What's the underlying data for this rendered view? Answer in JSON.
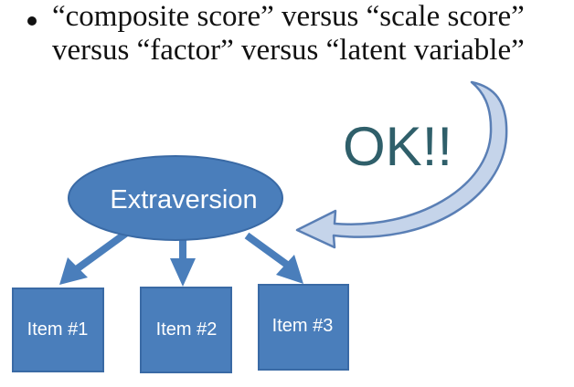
{
  "bullet": {
    "line1": "“composite score” versus “scale score”",
    "line2": "versus “factor” versus “latent variable”"
  },
  "callout": {
    "text": "OK!!"
  },
  "diagram": {
    "latent": "Extraversion",
    "items": [
      "Item #1",
      "Item #2",
      "Item #3"
    ]
  },
  "colors": {
    "node_fill": "#4a7ebb",
    "node_stroke": "#3a6aa5",
    "arrow_fill": "#4a7ebb",
    "curved_arrow_fill": "#c5d4ea",
    "curved_arrow_stroke": "#5a7fb5",
    "ok_text": "#2f5f6a"
  }
}
